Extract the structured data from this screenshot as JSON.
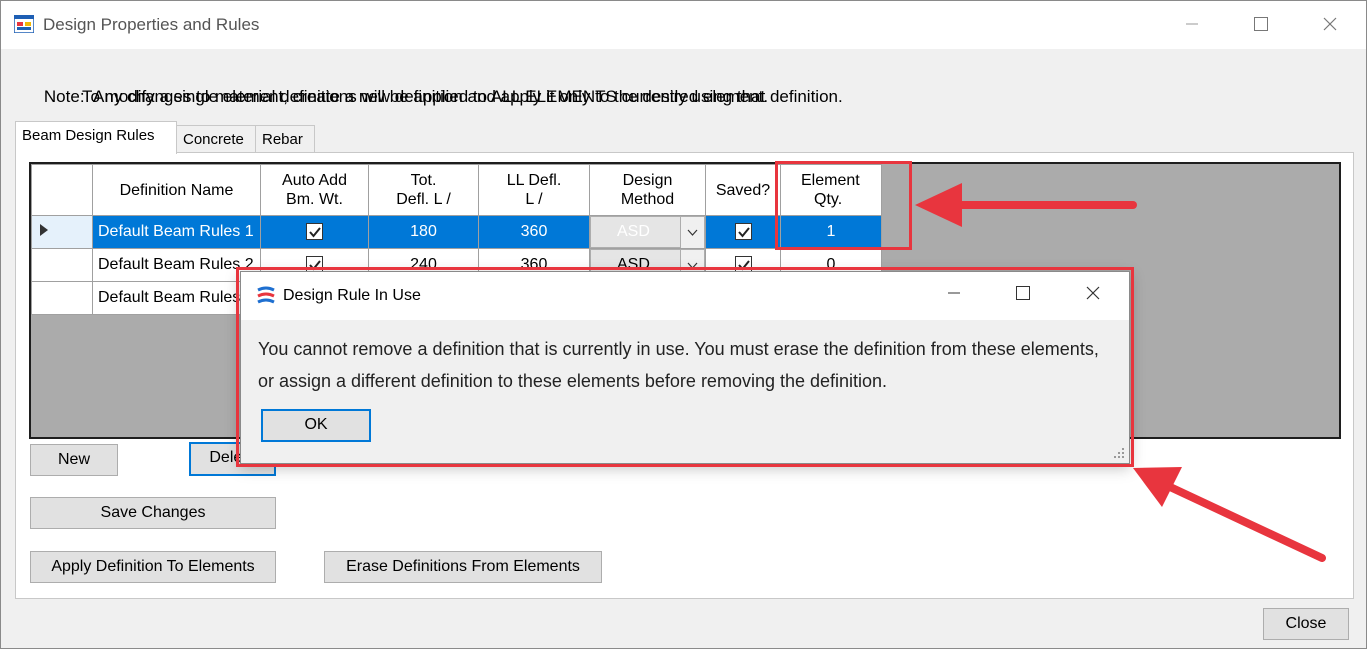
{
  "window": {
    "title": "Design Properties and Rules",
    "minimize_icon": "minimize-icon",
    "maximize_icon": "maximize-icon",
    "close_icon": "close-icon"
  },
  "note": {
    "line1": "Note:  Any changes to material definitions will be applied to ALL ELEMENTS currently using that definition.",
    "line2": "To modify a single element, create a new definition and apply it only to the desired element."
  },
  "tabs": [
    {
      "label": "Beam Design Rules",
      "active": true
    },
    {
      "label": "Concrete",
      "active": false
    },
    {
      "label": "Rebar",
      "active": false
    }
  ],
  "grid": {
    "headers": {
      "name": "Definition Name",
      "auto1": "Auto Add",
      "auto2": "Bm. Wt.",
      "tot1": "Tot.",
      "tot2": "Defl. L /",
      "ll1": "LL Defl.",
      "ll2": "L /",
      "dm1": "Design",
      "dm2": "Method",
      "saved": "Saved?",
      "eq1": "Element",
      "eq2": "Qty."
    },
    "rows": [
      {
        "name": "Default Beam Rules 1",
        "auto_add": true,
        "tot_defl": "180",
        "ll_defl": "360",
        "method": "ASD",
        "saved": true,
        "qty": "1"
      },
      {
        "name": "Default Beam Rules 2",
        "auto_add": true,
        "tot_defl": "240",
        "ll_defl": "360",
        "method": "ASD",
        "saved": true,
        "qty": "0"
      },
      {
        "name": "Default Beam Rules",
        "auto_add": false,
        "tot_defl": "",
        "ll_defl": "",
        "method": "",
        "saved": false,
        "qty": ""
      }
    ]
  },
  "buttons": {
    "new": "New",
    "delete": "Delete",
    "save_changes": "Save Changes",
    "apply": "Apply Definition To Elements",
    "erase": "Erase Definitions From Elements",
    "close": "Close"
  },
  "dialog": {
    "title": "Design Rule In Use",
    "message": "You cannot remove a definition that is currently in use.  You must erase the definition from these elements, or assign a different definition to these elements before removing the definition.",
    "ok": "OK"
  },
  "colors": {
    "selection": "#0078d7",
    "annotation_red": "#e8353e",
    "grid_background": "#ababab"
  }
}
